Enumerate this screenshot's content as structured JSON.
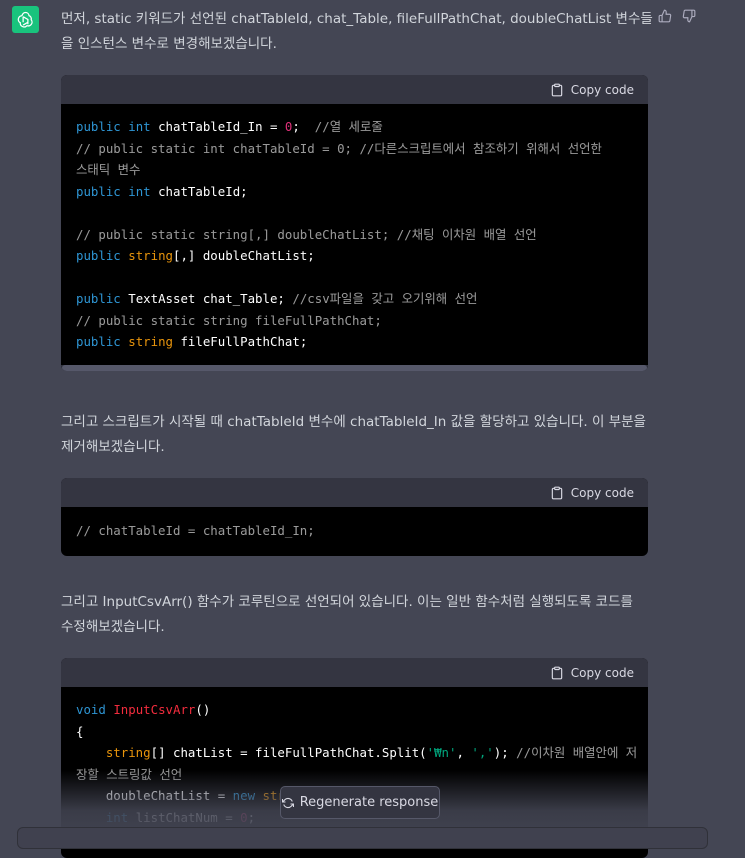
{
  "message": {
    "intro": "먼저, static 키워드가 선언된 chatTableId, chat_Table, fileFullPathChat, doubleChatList 변수들을 인스턴스 변수로 변경해보겠습니다.",
    "para2": "그리고 스크립트가 시작될 때 chatTableId 변수에 chatTableId_In 값을 할당하고 있습니다. 이 부분을 제거해보겠습니다.",
    "para3": "그리고 InputCsvArr() 함수가 코루틴으로 선언되어 있습니다. 이는 일반 함수처럼 실행되도록 코드를 수정해보겠습니다."
  },
  "code_header": {
    "copy_label": "Copy code"
  },
  "code1": {
    "l1_kw": "public",
    "l1_ty": "int",
    "l1_var": "chatTableId_In = ",
    "l1_num": "0",
    "l1_end": ";  ",
    "l1_cm": "//열 세로줄",
    "l2": "// public static int chatTableId = 0; //다른스크립트에서 참조하기 위해서 선언한",
    "l3": "스태틱 변수",
    "l4_kw": "public",
    "l4_ty": "int",
    "l4_var": "chatTableId;",
    "l6": "// public static string[,] doubleChatList; //채팅 이차원 배열 선언",
    "l7_kw": "public",
    "l7_ty": "string",
    "l7_var": "[,] doubleChatList;",
    "l9_kw": "public",
    "l9_var": "TextAsset chat_Table; ",
    "l9_cm": "//csv파일을 갖고 오기위해 선언",
    "l10": "// public static string fileFullPathChat;",
    "l11_kw": "public",
    "l11_ty": "string",
    "l11_var": "fileFullPathChat;"
  },
  "code2": {
    "l1": "// chatTableId = chatTableId_In;"
  },
  "code3": {
    "l1_kw": "void",
    "l1_fn": "InputCsvArr",
    "l1_end": "()",
    "l2": "{",
    "l3_ty": "string",
    "l3_a": "[] chatList = fileFullPathChat.Split(",
    "l3_s1": "'₩n'",
    "l3_c": ", ",
    "l3_s2": "','",
    "l3_b": "); ",
    "l3_cm": "//이차원 배열안에 저",
    "l4": "장할 스트링값 선언",
    "l5_a": "doubleChatList = ",
    "l5_kw": "new",
    "l5_b": " strin",
    "l6_ty": "int",
    "l6_a": " listChatNum = ",
    "l6_num": "0",
    "l6_b": ";"
  },
  "regenerate": {
    "label": "Regenerate response"
  },
  "colors": {
    "accent": "#19c37d",
    "background": "#444654",
    "code_bg": "#000000"
  },
  "icons": [
    "openai-logo-icon",
    "thumbs-up-icon",
    "thumbs-down-icon",
    "clipboard-icon",
    "refresh-icon"
  ]
}
